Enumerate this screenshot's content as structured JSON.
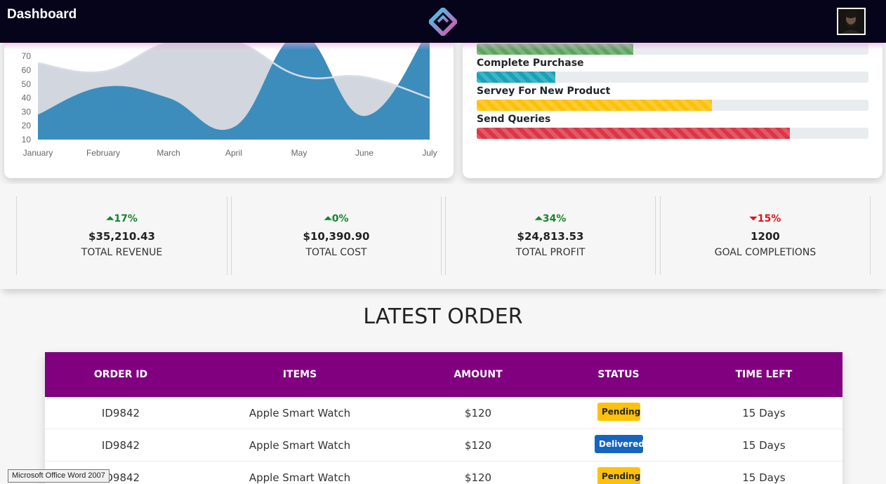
{
  "header": {
    "title": "Dashboard",
    "logo_icon": "brand-logo-icon",
    "avatar_icon": "user-avatar-icon"
  },
  "chart_data": {
    "type": "area",
    "categories": [
      "January",
      "February",
      "March",
      "April",
      "May",
      "June",
      "July"
    ],
    "y_ticks": [
      10,
      20,
      30,
      40,
      50,
      60,
      70
    ],
    "ylim": [
      10,
      80
    ],
    "series": [
      {
        "values": [
          65,
          59,
          80,
          81,
          56,
          55,
          40
        ],
        "color": "#d2d6de"
      },
      {
        "values": [
          28,
          48,
          40,
          19,
          86,
          27,
          90
        ],
        "color": "#3c8dbc"
      }
    ]
  },
  "progress": [
    {
      "label": "",
      "value": 40,
      "color": "#5ba45e"
    },
    {
      "label": "Complete Purchase",
      "value": 20,
      "color": "#17a2b8"
    },
    {
      "label": "Servey For New Product",
      "value": 60,
      "color": "#ffc107"
    },
    {
      "label": "Send Queries",
      "value": 80,
      "color": "#dc3545"
    }
  ],
  "stats": [
    {
      "pct": "17%",
      "dir": "up",
      "value": "$35,210.43",
      "label": "TOTAL REVENUE"
    },
    {
      "pct": "0%",
      "dir": "up",
      "value": "$10,390.90",
      "label": "TOTAL COST"
    },
    {
      "pct": "34%",
      "dir": "up",
      "value": "$24,813.53",
      "label": "TOTAL PROFIT"
    },
    {
      "pct": "15%",
      "dir": "down",
      "value": "1200",
      "label": "GOAL COMPLETIONS"
    }
  ],
  "orders": {
    "title": "LATEST ORDER",
    "columns": [
      "ORDER ID",
      "ITEMS",
      "AMOUNT",
      "STATUS",
      "TIME LEFT"
    ],
    "rows": [
      {
        "id": "ID9842",
        "item": "Apple Smart Watch",
        "amount": "$120",
        "status": "Pending",
        "time": "15 Days"
      },
      {
        "id": "ID9842",
        "item": "Apple Smart Watch",
        "amount": "$120",
        "status": "Delivered",
        "time": "15 Days"
      },
      {
        "id": "ID9842",
        "item": "Apple Smart Watch",
        "amount": "$120",
        "status": "Pending",
        "time": "15 Days"
      }
    ]
  },
  "tooltip": "Microsoft Office Word 2007"
}
